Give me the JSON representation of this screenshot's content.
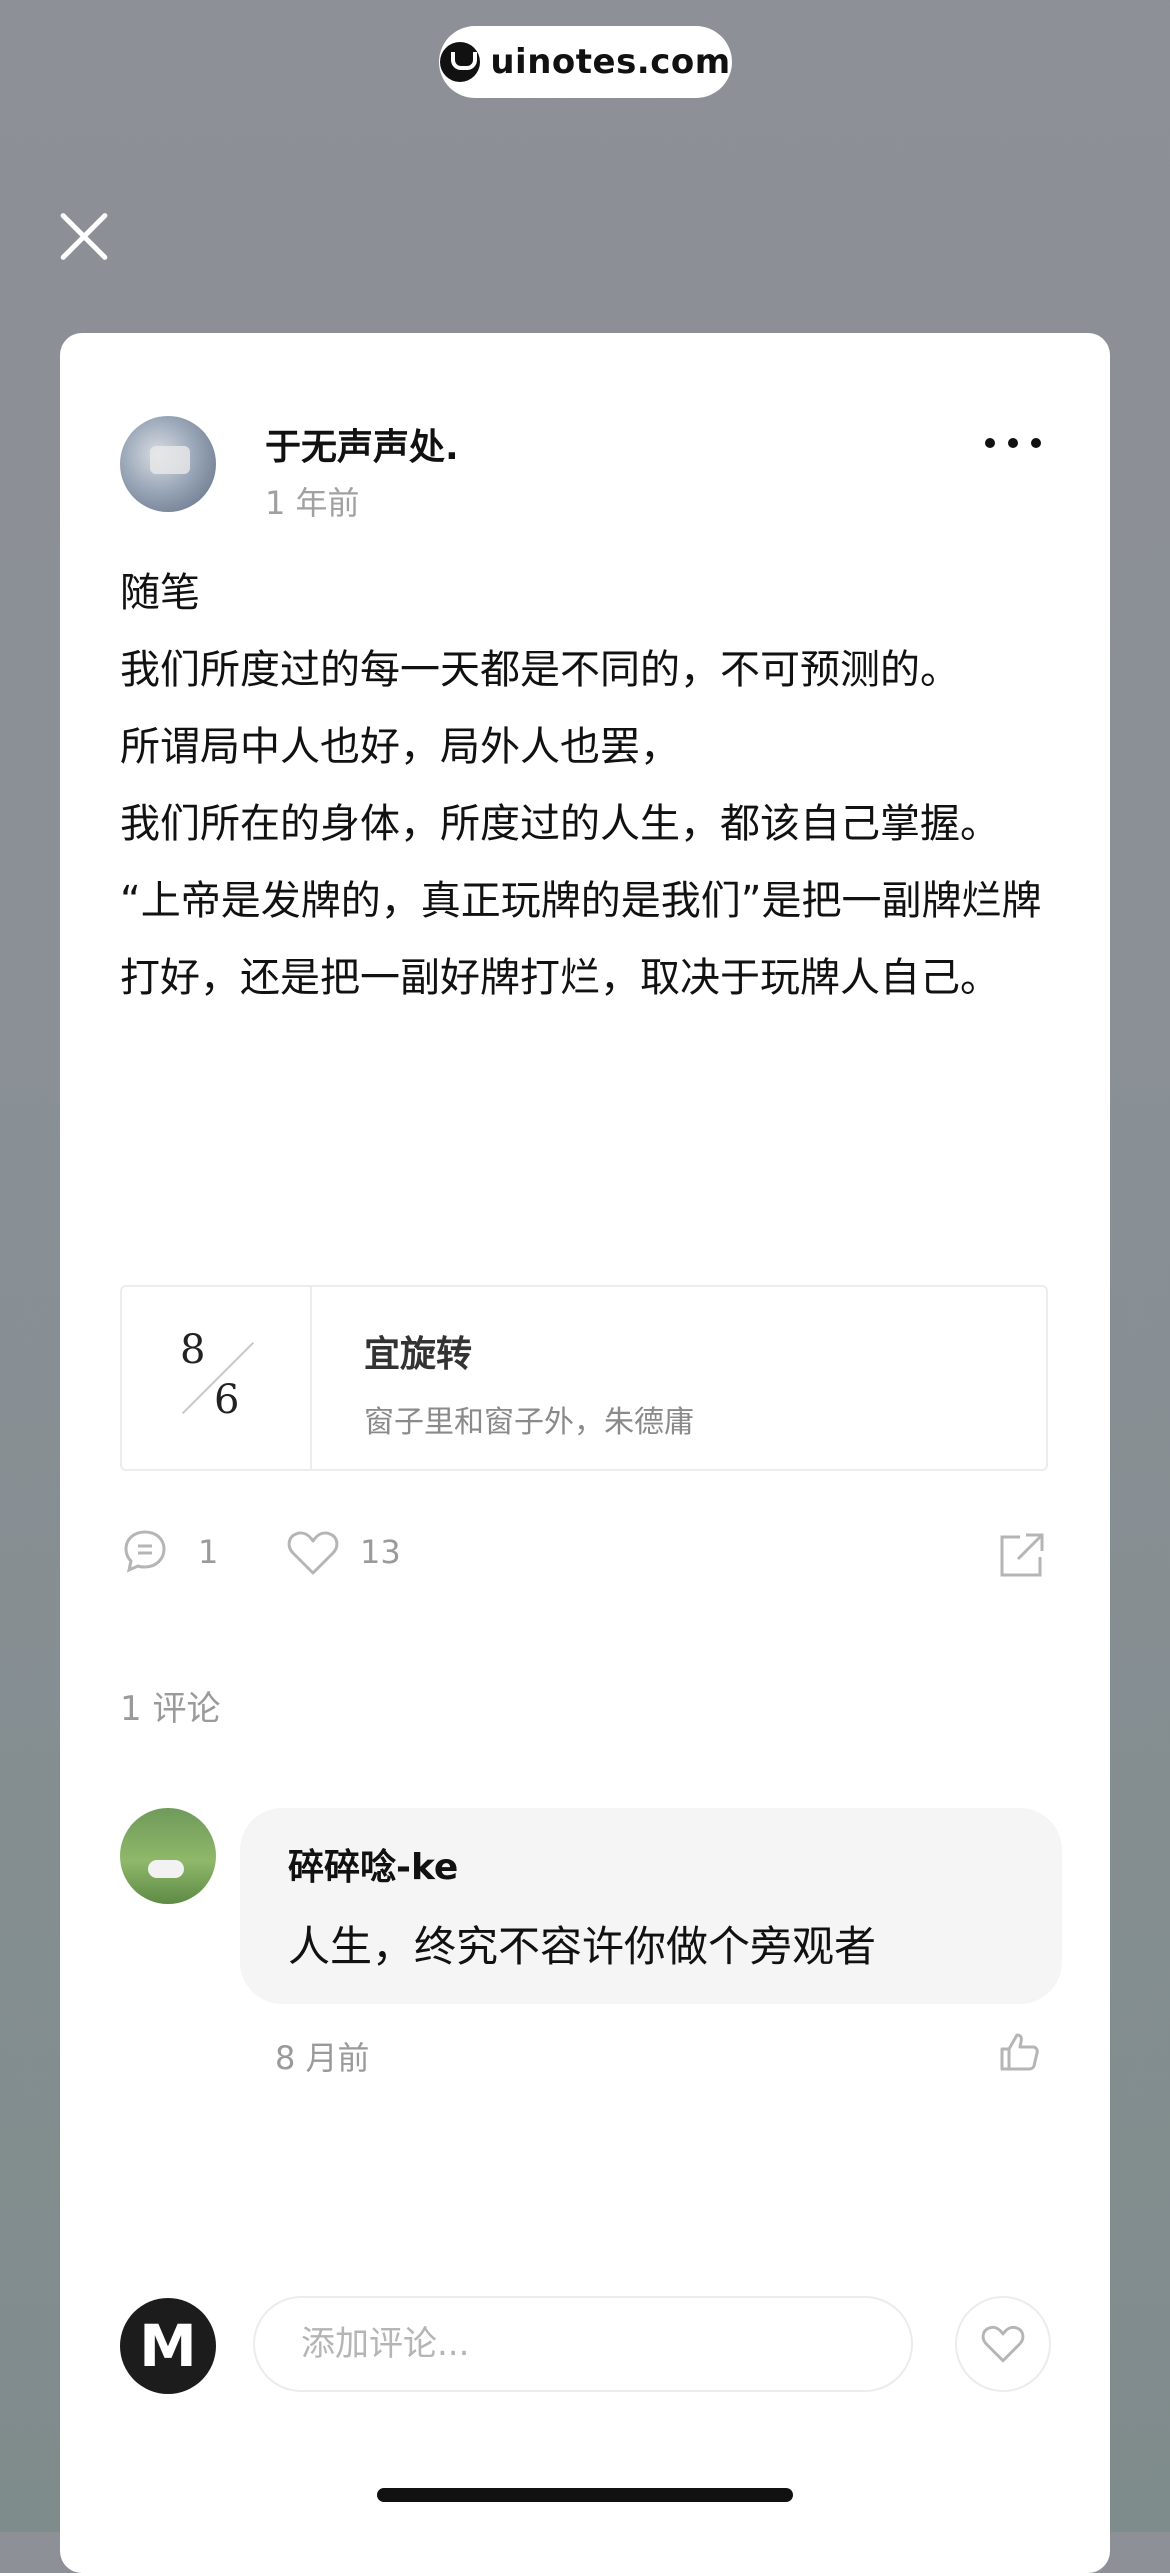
{
  "watermark": {
    "text": "uinotes.com"
  },
  "post": {
    "author": "于无声声处.",
    "time": "1 年前",
    "paragraphs": [
      "随笔",
      "我们所度过的每一天都是不同的，不可预测的。",
      "所谓局中人也好，局外人也罢，",
      "我们所在的身体，所度过的人生，都该自己掌握。",
      "“上帝是发牌的，真正玩牌的是我们”是把一副牌烂牌打好，还是把一副好牌打烂，取决于玩牌人自己。"
    ],
    "quote_card": {
      "month": "8",
      "day": "6",
      "title": "宜旋转",
      "subtitle": "窗子里和窗子外，朱德庸"
    },
    "comment_count": "1",
    "like_count": "13"
  },
  "comments": {
    "heading": "1 评论",
    "items": [
      {
        "user": "碎碎唸-ke",
        "text": "人生，终究不容许你做个旁观者",
        "time": "8 月前"
      }
    ]
  },
  "composer": {
    "avatar_letter": "M",
    "placeholder": "添加评论..."
  },
  "colors": {
    "background": "#8a9096",
    "card": "#ffffff",
    "muted_text": "#9a9a9a",
    "bubble": "#f5f5f5"
  },
  "icons": [
    "close-icon",
    "more-icon",
    "comment-icon",
    "heart-icon",
    "share-icon",
    "thumbs-up-icon"
  ]
}
